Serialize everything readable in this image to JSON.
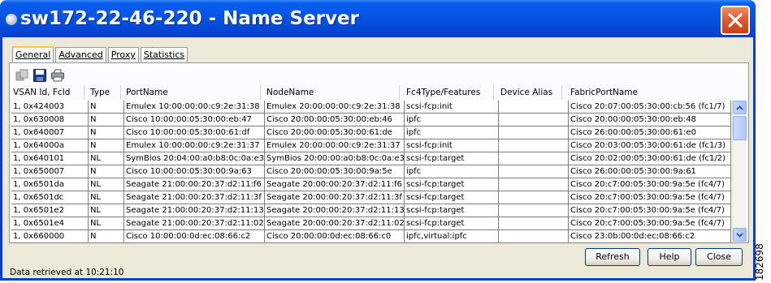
{
  "window": {
    "title": "sw172-22-46-220 - Name Server"
  },
  "tabs": [
    {
      "label": "General",
      "active": true
    },
    {
      "label": "Advanced",
      "active": false
    },
    {
      "label": "Proxy",
      "active": false
    },
    {
      "label": "Statistics",
      "active": false
    }
  ],
  "toolbar": {
    "icons": [
      "copy-icon",
      "save-icon",
      "print-icon"
    ]
  },
  "table": {
    "columns": [
      "VSAN Id, FcId",
      "Type",
      "PortName",
      "NodeName",
      "Fc4Type/Features",
      "Device Alias",
      "FabricPortName"
    ],
    "rows": [
      [
        "1, 0x424003",
        "N",
        "Emulex 10:00:00:00:c9:2e:31:38",
        "Emulex 20:00:00:00:c9:2e:31:38",
        "scsi-fcp:init",
        "",
        "Cisco 20:07:00:05:30:00:cb:56 (fc1/7)"
      ],
      [
        "1, 0x630008",
        "N",
        "Cisco 10:00:00:05:30:00:eb:47",
        "Cisco 20:00:00:05:30:00:eb:46",
        "ipfc",
        "",
        "Cisco 20:00:00:05:30:00:eb:48"
      ],
      [
        "1, 0x640007",
        "N",
        "Cisco 10:00:00:05:30:00:61:df",
        "Cisco 20:00:00:05:30:00:61:de",
        "ipfc",
        "",
        "Cisco 26:00:00:05:30:00:61:e0"
      ],
      [
        "1, 0x64000a",
        "N",
        "Emulex 10:00:00:00:c9:2e:31:37",
        "Emulex 20:00:00:00:c9:2e:31:37",
        "scsi-fcp:init",
        "",
        "Cisco 20:03:00:05:30:00:61:de (fc1/3)"
      ],
      [
        "1, 0x640101",
        "NL",
        "SymBios 20:04:00:a0:b8:0c:0a:e3",
        "SymBios 20:00:00:a0:b8:0c:0a:e3",
        "scsi-fcp:target",
        "",
        "Cisco 20:02:00:05:30:00:61:de (fc1/2)"
      ],
      [
        "1, 0x650007",
        "N",
        "Cisco 10:00:00:05:30:00:9a:63",
        "Cisco 20:00:00:05:30:00:9a:5e",
        "ipfc",
        "",
        "Cisco 26:00:00:05:30:00:9a:61"
      ],
      [
        "1, 0x6501da",
        "NL",
        "Seagate 21:00:00:20:37:d2:11:f6",
        "Seagate 20:00:00:20:37:d2:11:f6",
        "scsi-fcp:target",
        "",
        "Cisco 20:c7:00:05:30:00:9a:5e (fc4/7)"
      ],
      [
        "1, 0x6501dc",
        "NL",
        "Seagate 21:00:00:20:37:d2:11:3f",
        "Seagate 20:00:00:20:37:d2:11:3f",
        "scsi-fcp:target",
        "",
        "Cisco 20:c7:00:05:30:00:9a:5e (fc4/7)"
      ],
      [
        "1, 0x6501e2",
        "NL",
        "Seagate 21:00:00:20:37:d2:11:13",
        "Seagate 20:00:00:20:37:d2:11:13",
        "scsi-fcp:target",
        "",
        "Cisco 20:c7:00:05:30:00:9a:5e (fc4/7)"
      ],
      [
        "1, 0x6501e4",
        "NL",
        "Seagate 21:00:00:20:37:d2:11:02",
        "Seagate 20:00:00:20:37:d2:11:02",
        "scsi-fcp:target",
        "",
        "Cisco 20:c7:00:05:30:00:9a:5e (fc4/7)"
      ],
      [
        "1, 0x660000",
        "N",
        "Cisco 10:00:00:0d:ec:08:66:c2",
        "Cisco 20:00:00:0d:ec:08:66:c0",
        "ipfc,virtual:ipfc",
        "",
        "Cisco 23:0b:00:0d:ec:08:66:c2"
      ]
    ]
  },
  "buttons": {
    "refresh": "Refresh",
    "help": "Help",
    "close": "Close"
  },
  "status": "Data retrieved at 10:21:10",
  "figure_id": "182698",
  "colors": {
    "title_bar": "#0554e3",
    "close_button": "#e0562c",
    "dialog_bg": "#ece9d8",
    "grid_line": "#808080"
  }
}
